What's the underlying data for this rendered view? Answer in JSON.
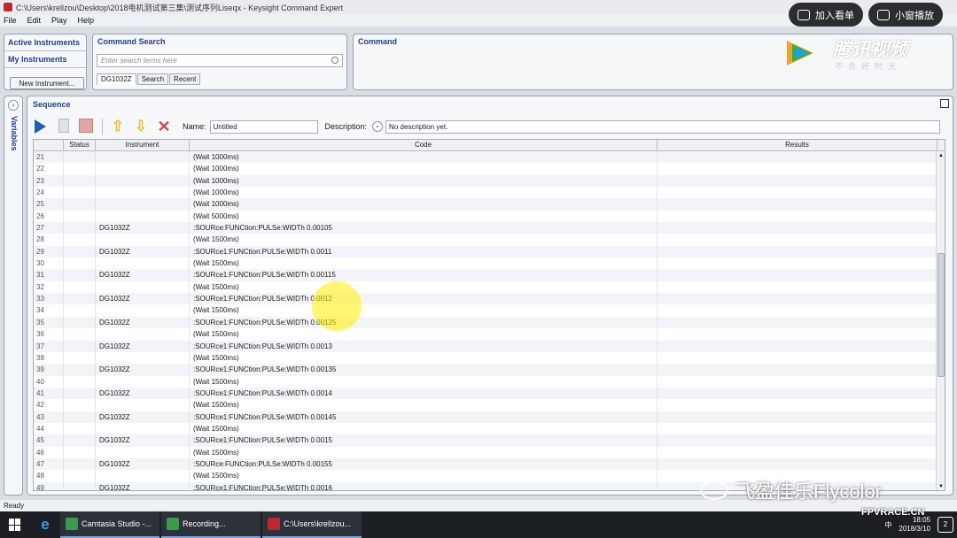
{
  "window": {
    "title": "C:\\Users\\krellzou\\Desktop\\2018电机测试第三集\\测试序列Liseqx - Keysight Command Expert"
  },
  "menu": [
    "File",
    "Edit",
    "Play",
    "Help"
  ],
  "overlay": {
    "add_list": "加入看单",
    "mini_play": "小窗播放"
  },
  "left_panel": {
    "active": "Active Instruments",
    "mine": "My Instruments",
    "new_button": "New Instrument..."
  },
  "command_search": {
    "title": "Command Search",
    "placeholder": "Enter search terms here",
    "tabs": [
      "DG1032Z",
      "Search",
      "Recent"
    ]
  },
  "command": {
    "title": "Command"
  },
  "variables": {
    "label": "Variables"
  },
  "sequence": {
    "title": "Sequence",
    "name_label": "Name:",
    "name_value": "Untitled",
    "desc_label": "Description:",
    "desc_value": "No description yet.",
    "columns": [
      "",
      "Status",
      "Instrument",
      "Code",
      "Results"
    ],
    "rows": [
      {
        "n": "21",
        "instr": "",
        "code": "(Wait 1000ms)"
      },
      {
        "n": "22",
        "instr": "",
        "code": "(Wait 1000ms)"
      },
      {
        "n": "23",
        "instr": "",
        "code": "(Wait 1000ms)"
      },
      {
        "n": "24",
        "instr": "",
        "code": "(Wait 1000ms)"
      },
      {
        "n": "25",
        "instr": "",
        "code": "(Wait 1000ms)"
      },
      {
        "n": "26",
        "instr": "",
        "code": "(Wait 5000ms)"
      },
      {
        "n": "27",
        "instr": "DG1032Z",
        "code": ":SOURce:FUNCtion:PULSe:WIDTh 0.00105"
      },
      {
        "n": "28",
        "instr": "",
        "code": "(Wait 1500ms)"
      },
      {
        "n": "29",
        "instr": "DG1032Z",
        "code": ":SOURce1:FUNCtion:PULSe:WIDTh 0.0011"
      },
      {
        "n": "30",
        "instr": "",
        "code": "(Wait 1500ms)"
      },
      {
        "n": "31",
        "instr": "DG1032Z",
        "code": ":SOURce1:FUNCtion:PULSe:WIDTh 0.00115"
      },
      {
        "n": "32",
        "instr": "",
        "code": "(Wait 1500ms)"
      },
      {
        "n": "33",
        "instr": "DG1032Z",
        "code": ":SOURce1:FUNCtion:PULSe:WIDTh 0.0012"
      },
      {
        "n": "34",
        "instr": "",
        "code": "(Wait 1500ms)"
      },
      {
        "n": "35",
        "instr": "DG1032Z",
        "code": ":SOURce1:FUNCtion:PULSe:WIDTh 0.00125"
      },
      {
        "n": "36",
        "instr": "",
        "code": "(Wait 1500ms)"
      },
      {
        "n": "37",
        "instr": "DG1032Z",
        "code": ":SOURce1:FUNCtion:PULSe:WIDTh 0.0013"
      },
      {
        "n": "38",
        "instr": "",
        "code": "(Wait 1500ms)"
      },
      {
        "n": "39",
        "instr": "DG1032Z",
        "code": ":SOURce1:FUNCtion:PULSe:WIDTh 0.00135"
      },
      {
        "n": "40",
        "instr": "",
        "code": "(Wait 1500ms)"
      },
      {
        "n": "41",
        "instr": "DG1032Z",
        "code": ":SOURce1:FUNCtion:PULSe:WIDTh 0.0014"
      },
      {
        "n": "42",
        "instr": "",
        "code": "(Wait 1500ms)"
      },
      {
        "n": "43",
        "instr": "DG1032Z",
        "code": ":SOURce1:FUNCtion:PULSe:WIDTh 0.00145"
      },
      {
        "n": "44",
        "instr": "",
        "code": "(Wait 1500ms)"
      },
      {
        "n": "45",
        "instr": "DG1032Z",
        "code": ":SOURce1:FUNCtion:PULSe:WIDTh 0.0015"
      },
      {
        "n": "46",
        "instr": "",
        "code": "(Wait 1500ms)"
      },
      {
        "n": "47",
        "instr": "DG1032Z",
        "code": ":SOURce:FUNCtion:PULSe:WIDTh 0.00155"
      },
      {
        "n": "48",
        "instr": "",
        "code": "(Wait 1500ms)"
      },
      {
        "n": "49",
        "instr": "DG1032Z",
        "code": ":SOURce1:FUNCtion:PULSe:WIDTh 0.0016"
      }
    ]
  },
  "statusbar": {
    "text": "Ready"
  },
  "taskbar": {
    "items": [
      {
        "label": "Camtasia Studio -...",
        "color": "#3a9b4a"
      },
      {
        "label": "Recording...",
        "color": "#3a9b4a"
      },
      {
        "label": "C:\\Users\\krellzou...",
        "color": "#c0282f"
      }
    ],
    "clock_time": "18:05",
    "clock_date": "2018/3/10",
    "ime": "中",
    "notif_count": "2"
  },
  "watermarks": {
    "brand": "腾讯视频",
    "brand_sub": "不负好时光",
    "wechat": "飞盈佳乐Flycolor",
    "site": "FPVRACE.CN"
  }
}
